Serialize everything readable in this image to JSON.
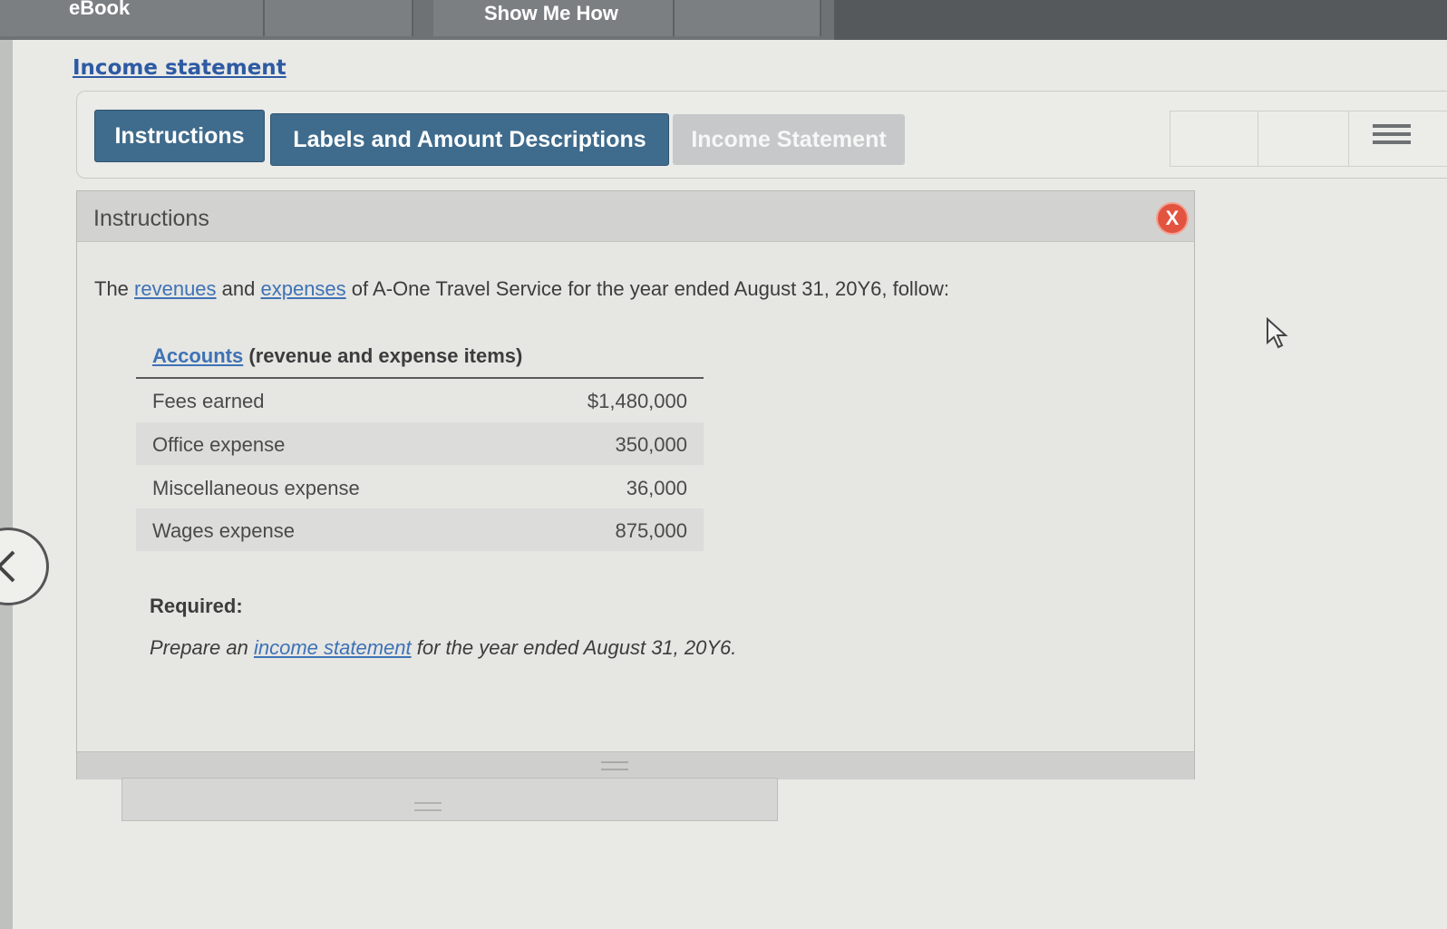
{
  "topbar": {
    "ebook_label": "eBook",
    "show_me_how_label": "Show Me How"
  },
  "page": {
    "title_link": "Income statement"
  },
  "tabs": [
    {
      "label": "Instructions",
      "active": true
    },
    {
      "label": "Labels and Amount Descriptions",
      "active": true
    },
    {
      "label": "Income Statement",
      "active": false
    }
  ],
  "panel": {
    "title": "Instructions",
    "close_label": "X",
    "intro": {
      "prefix": "The ",
      "link1": "revenues",
      "mid": " and ",
      "link2": "expenses",
      "suffix": " of A-One Travel Service for the year ended August 31, 20Y6, follow:"
    },
    "accounts_header": {
      "link": "Accounts",
      "rest": " (revenue and expense items)"
    },
    "accounts": [
      {
        "label": "Fees earned",
        "amount": "$1,480,000"
      },
      {
        "label": "Office expense",
        "amount": "350,000"
      },
      {
        "label": "Miscellaneous expense",
        "amount": "36,000"
      },
      {
        "label": "Wages expense",
        "amount": "875,000"
      }
    ],
    "required_label": "Required:",
    "required": {
      "prefix": "Prepare an ",
      "link": "income statement",
      "suffix": " for the year ended August 31, 20Y6."
    }
  },
  "icons": {
    "menu": "list-menu-icon",
    "back": "chevron-left-icon",
    "cursor": "mouse-pointer-icon",
    "close": "close-icon"
  },
  "colors": {
    "tab_active": "#3f6b8c",
    "tab_inactive": "#c6c8c9",
    "link": "#3e72b5",
    "close": "#e2543f"
  }
}
